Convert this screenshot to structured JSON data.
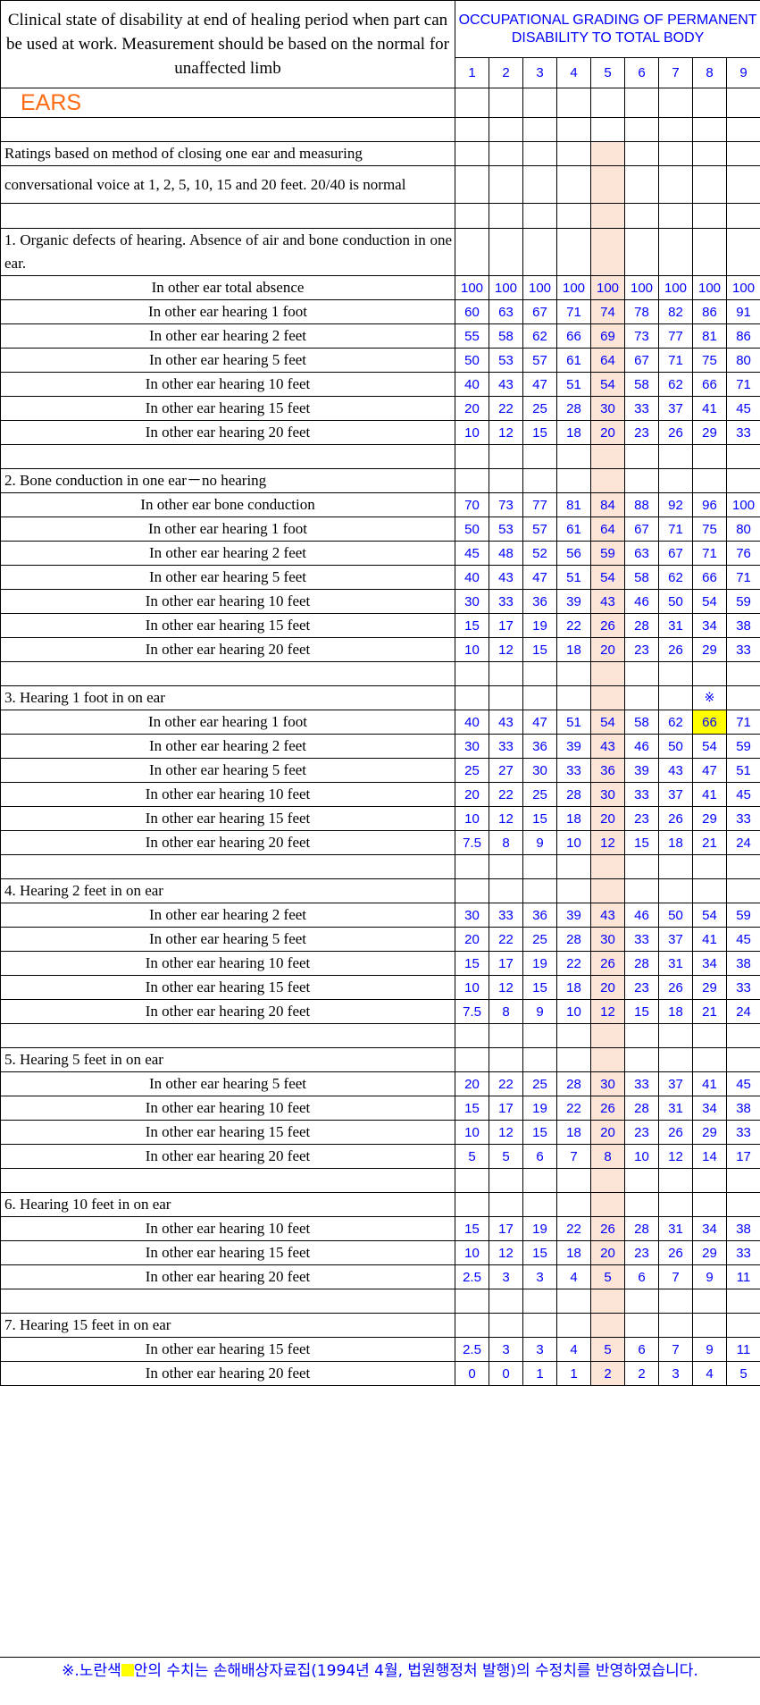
{
  "header": {
    "left_text": "Clinical  state of disability at end of healing period when part can be used at work. Measurement should be based on the normal for unaffected limb",
    "right_title": "OCCUPATIONAL GRADING OF PERMANENT DISABILITY TO TOTAL BODY",
    "columns": [
      "1",
      "2",
      "3",
      "4",
      "5",
      "6",
      "7",
      "8",
      "9"
    ]
  },
  "section_title": "EARS",
  "rows": [
    {
      "type": "blank",
      "h": 27
    },
    {
      "type": "text",
      "h": 27,
      "text": "Ratings based on method of closing one ear and measuring"
    },
    {
      "type": "text",
      "h": 42,
      "text": " conversational voice at 1, 2, 5, 10, 15 and 20 feet. 20/40 is normal"
    },
    {
      "type": "blank",
      "h": 28,
      "dashed": true
    },
    {
      "type": "text",
      "h": 43,
      "text": "1. Organic defects of hearing. Absence of air and bone conduction in one ear.",
      "justify": true
    },
    {
      "type": "data",
      "label": "In other ear total absence",
      "values": [
        "100",
        "100",
        "100",
        "100",
        "100",
        "100",
        "100",
        "100",
        "100"
      ]
    },
    {
      "type": "data",
      "label": "In other ear hearing 1 foot",
      "values": [
        "60",
        "63",
        "67",
        "71",
        "74",
        "78",
        "82",
        "86",
        "91"
      ]
    },
    {
      "type": "data",
      "label": "In other ear hearing 2 feet",
      "values": [
        "55",
        "58",
        "62",
        "66",
        "69",
        "73",
        "77",
        "81",
        "86"
      ]
    },
    {
      "type": "data",
      "label": "In other ear hearing 5 feet",
      "values": [
        "50",
        "53",
        "57",
        "61",
        "64",
        "67",
        "71",
        "75",
        "80"
      ]
    },
    {
      "type": "data",
      "label": "In other ear hearing 10 feet",
      "values": [
        "40",
        "43",
        "47",
        "51",
        "54",
        "58",
        "62",
        "66",
        "71"
      ]
    },
    {
      "type": "data",
      "label": "In other ear hearing 15 feet",
      "values": [
        "20",
        "22",
        "25",
        "28",
        "30",
        "33",
        "37",
        "41",
        "45"
      ]
    },
    {
      "type": "data",
      "label": "In other ear hearing 20 feet",
      "values": [
        "10",
        "12",
        "15",
        "18",
        "20",
        "23",
        "26",
        "29",
        "33"
      ]
    },
    {
      "type": "blank",
      "h": 27,
      "dashed": true
    },
    {
      "type": "text",
      "h": 27,
      "text": "2. Bone conduction in one ear－no hearing"
    },
    {
      "type": "data",
      "label": "In other ear bone conduction",
      "values": [
        "70",
        "73",
        "77",
        "81",
        "84",
        "88",
        "92",
        "96",
        "100"
      ]
    },
    {
      "type": "data",
      "label": "In other ear hearing 1 foot",
      "values": [
        "50",
        "53",
        "57",
        "61",
        "64",
        "67",
        "71",
        "75",
        "80"
      ]
    },
    {
      "type": "data",
      "label": "In other ear hearing 2 feet",
      "values": [
        "45",
        "48",
        "52",
        "56",
        "59",
        "63",
        "67",
        "71",
        "76"
      ]
    },
    {
      "type": "data",
      "label": "In other ear hearing 5 feet",
      "values": [
        "40",
        "43",
        "47",
        "51",
        "54",
        "58",
        "62",
        "66",
        "71"
      ]
    },
    {
      "type": "data",
      "label": "In other ear hearing 10 feet",
      "values": [
        "30",
        "33",
        "36",
        "39",
        "43",
        "46",
        "50",
        "54",
        "59"
      ]
    },
    {
      "type": "data",
      "label": "In other ear hearing 15 feet",
      "values": [
        "15",
        "17",
        "19",
        "22",
        "26",
        "28",
        "31",
        "34",
        "38"
      ]
    },
    {
      "type": "data",
      "label": "In other ear hearing 20 feet",
      "values": [
        "10",
        "12",
        "15",
        "18",
        "20",
        "23",
        "26",
        "29",
        "33"
      ]
    },
    {
      "type": "blank",
      "h": 27,
      "dashed": true
    },
    {
      "type": "text",
      "h": 27,
      "text": "3. Hearing 1 foot in on ear",
      "mark": "※"
    },
    {
      "type": "data",
      "label": "In other ear hearing 1 foot",
      "values": [
        "40",
        "43",
        "47",
        "51",
        "54",
        "58",
        "62",
        "66",
        "71"
      ],
      "highlight": 7
    },
    {
      "type": "data",
      "label": "In other ear hearing 2 feet",
      "values": [
        "30",
        "33",
        "36",
        "39",
        "43",
        "46",
        "50",
        "54",
        "59"
      ]
    },
    {
      "type": "data",
      "label": "In other ear hearing 5 feet",
      "values": [
        "25",
        "27",
        "30",
        "33",
        "36",
        "39",
        "43",
        "47",
        "51"
      ]
    },
    {
      "type": "data",
      "label": "In other ear hearing 10 feet",
      "values": [
        "20",
        "22",
        "25",
        "28",
        "30",
        "33",
        "37",
        "41",
        "45"
      ]
    },
    {
      "type": "data",
      "label": "In other ear hearing 15 feet",
      "values": [
        "10",
        "12",
        "15",
        "18",
        "20",
        "23",
        "26",
        "29",
        "33"
      ]
    },
    {
      "type": "data",
      "label": "In other ear hearing 20 feet",
      "values": [
        "7.5",
        "8",
        "9",
        "10",
        "12",
        "15",
        "18",
        "21",
        "24"
      ]
    },
    {
      "type": "blank",
      "h": 27,
      "dashed": true
    },
    {
      "type": "text",
      "h": 27,
      "text": "4. Hearing 2 feet in on ear"
    },
    {
      "type": "data",
      "label": "In other ear hearing 2 feet",
      "values": [
        "30",
        "33",
        "36",
        "39",
        "43",
        "46",
        "50",
        "54",
        "59"
      ]
    },
    {
      "type": "data",
      "label": "In other ear hearing 5 feet",
      "values": [
        "20",
        "22",
        "25",
        "28",
        "30",
        "33",
        "37",
        "41",
        "45"
      ]
    },
    {
      "type": "data",
      "label": "In other ear hearing 10 feet",
      "values": [
        "15",
        "17",
        "19",
        "22",
        "26",
        "28",
        "31",
        "34",
        "38"
      ]
    },
    {
      "type": "data",
      "label": "In other ear hearing 15 feet",
      "values": [
        "10",
        "12",
        "15",
        "18",
        "20",
        "23",
        "26",
        "29",
        "33"
      ]
    },
    {
      "type": "data",
      "label": "In other ear hearing 20 feet",
      "values": [
        "7.5",
        "8",
        "9",
        "10",
        "12",
        "15",
        "18",
        "21",
        "24"
      ]
    },
    {
      "type": "blank",
      "h": 27,
      "dashed": true
    },
    {
      "type": "text",
      "h": 27,
      "text": "5. Hearing 5 feet in on ear"
    },
    {
      "type": "data",
      "label": "In other ear hearing 5 feet",
      "values": [
        "20",
        "22",
        "25",
        "28",
        "30",
        "33",
        "37",
        "41",
        "45"
      ]
    },
    {
      "type": "data",
      "label": "In other ear hearing 10 feet",
      "values": [
        "15",
        "17",
        "19",
        "22",
        "26",
        "28",
        "31",
        "34",
        "38"
      ]
    },
    {
      "type": "data",
      "label": "In other ear hearing 15 feet",
      "values": [
        "10",
        "12",
        "15",
        "18",
        "20",
        "23",
        "26",
        "29",
        "33"
      ]
    },
    {
      "type": "data",
      "label": "In other ear hearing 20 feet",
      "values": [
        "5",
        "5",
        "6",
        "7",
        "8",
        "10",
        "12",
        "14",
        "17"
      ]
    },
    {
      "type": "blank",
      "h": 27,
      "dashed": true
    },
    {
      "type": "text",
      "h": 27,
      "text": "6. Hearing 10 feet in on ear"
    },
    {
      "type": "data",
      "label": "In other ear hearing 10 feet",
      "values": [
        "15",
        "17",
        "19",
        "22",
        "26",
        "28",
        "31",
        "34",
        "38"
      ]
    },
    {
      "type": "data",
      "label": "In other ear hearing 15 feet",
      "values": [
        "10",
        "12",
        "15",
        "18",
        "20",
        "23",
        "26",
        "29",
        "33"
      ]
    },
    {
      "type": "data",
      "label": "In other ear hearing 20 feet",
      "values": [
        "2.5",
        "3",
        "3",
        "4",
        "5",
        "6",
        "7",
        "9",
        "11"
      ]
    },
    {
      "type": "blank",
      "h": 27,
      "dashed": true
    },
    {
      "type": "text",
      "h": 27,
      "text": "7. Hearing 15 feet in on ear"
    },
    {
      "type": "data",
      "label": "In other ear hearing 15 feet",
      "values": [
        "2.5",
        "3",
        "3",
        "4",
        "5",
        "6",
        "7",
        "9",
        "11"
      ]
    },
    {
      "type": "data",
      "label": "In other ear hearing 20 feet",
      "values": [
        "0",
        "0",
        "1",
        "1",
        "2",
        "2",
        "3",
        "4",
        "5"
      ]
    }
  ],
  "footnote": {
    "prefix": "※.노란색",
    "text": "안의 수치는 손해배상자료집(1994년 4월, 법원행정처 발행)의 수정치를 반영하였습니다."
  },
  "colors": {
    "value_blue": "#0000ff",
    "highlight_column": "#fce4d6",
    "highlight_cell": "#ffff00",
    "section_orange": "#ff6a13"
  }
}
